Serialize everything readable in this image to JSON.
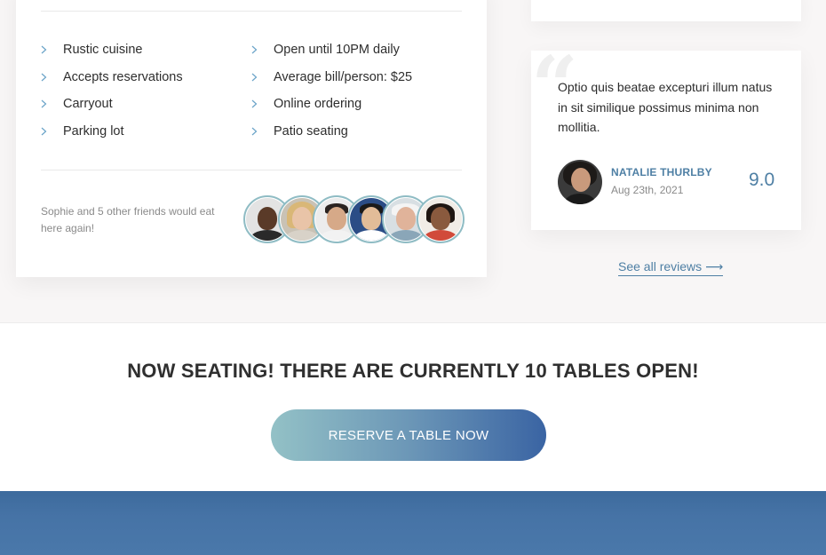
{
  "features": {
    "left": [
      "Rustic cuisine",
      "Accepts reservations",
      "Carryout",
      "Parking lot"
    ],
    "right": [
      "Open until 10PM daily",
      "Average bill/person: $25",
      "Online ordering",
      "Patio seating"
    ]
  },
  "friends": {
    "text": "Sophie and 5 other friends would eat here again!"
  },
  "review": {
    "text": "Optio quis beatae excepturi illum natus in sit similique possimus minima non mollitia.",
    "name": "NATALIE THURLBY",
    "date": "Aug 23th, 2021",
    "score": "9.0",
    "quote_icon": "quote-mark-icon"
  },
  "see_all": {
    "label": "See all reviews",
    "arrow": "⟶"
  },
  "seating": {
    "title": "NOW SEATING! THERE ARE CURRENTLY 10 TABLES OPEN!",
    "button_label": "RESERVE A TABLE NOW"
  },
  "colors": {
    "accent": "#4e7fa4",
    "chevron": "#6aa3c8",
    "avatar_ring": "#8fbcc4",
    "button_gradient_start": "#93c1c6",
    "button_gradient_end": "#3a64a3",
    "footer": "#4673a6"
  }
}
